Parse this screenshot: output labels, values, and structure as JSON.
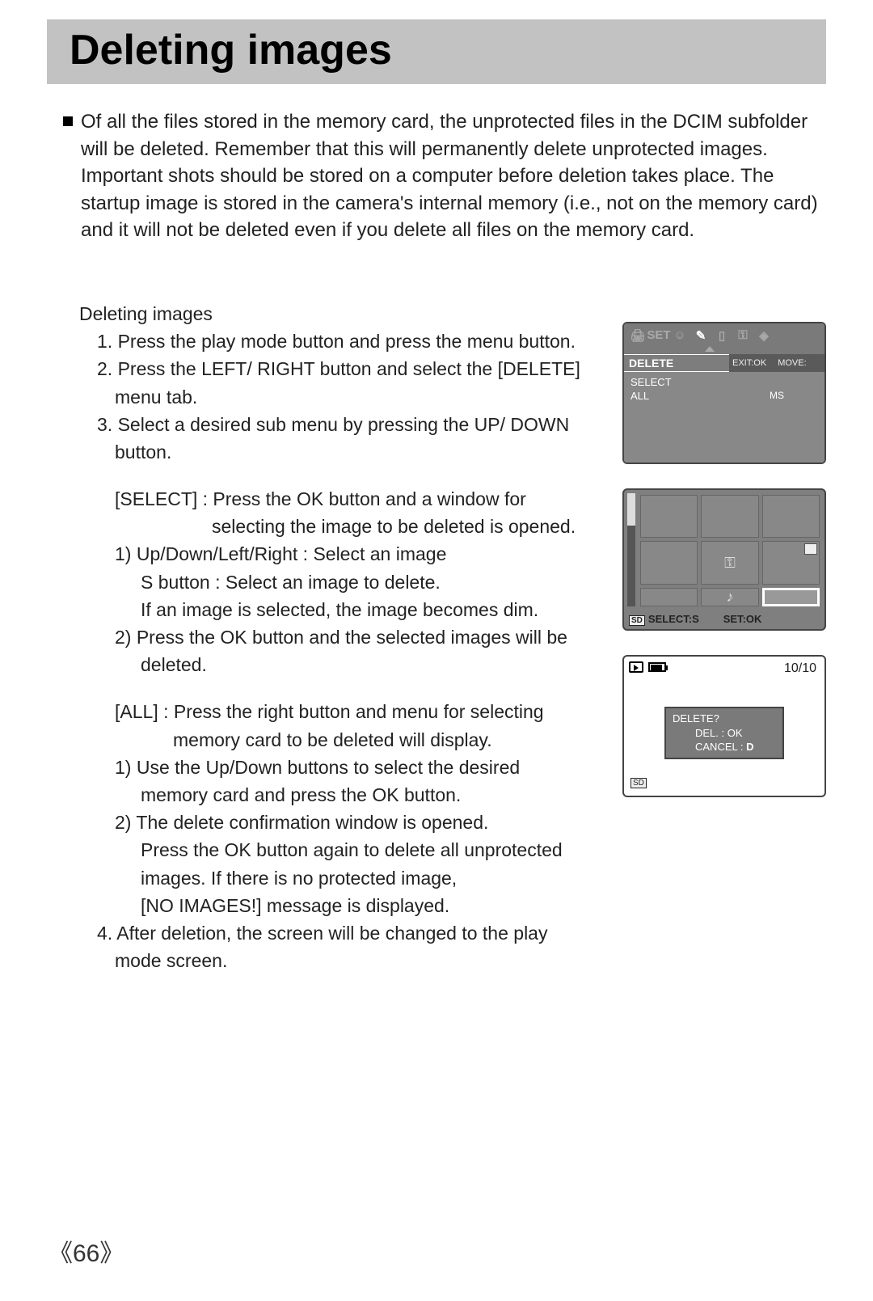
{
  "title": "Deleting images",
  "intro": "Of all the files stored in the memory card, the unprotected files in the DCIM subfolder will be deleted. Remember that this will permanently delete unprotected images. Important shots should be stored on a computer before deletion takes place. The startup image is stored in the camera's internal memory (i.e., not on the memory card) and it will not be deleted even if you delete all files on the memory card.",
  "section_heading": "Deleting images",
  "steps": {
    "s1": "1. Press the play mode button and press the menu button.",
    "s2a": "2. Press the LEFT/ RIGHT button and select the [DELETE]",
    "s2b": "menu tab.",
    "s3a": "3. Select a desired sub menu by pressing the UP/ DOWN",
    "s3b": "button.",
    "sel_a": "[SELECT] :  Press the OK button and a window for",
    "sel_b": "selecting the image to be deleted is opened.",
    "sub1a": "1) Up/Down/Left/Right : Select an image",
    "sub1b": "S button : Select an image to delete.",
    "sub1c": "If an image is selected, the image becomes dim.",
    "sub2a": "2) Press the OK button and the selected images will be",
    "sub2b": "deleted.",
    "all_a": "[ALL] : Press the right button and menu for selecting",
    "all_b": "memory card to be deleted will display.",
    "asub1a": "1) Use the Up/Down buttons to select the desired",
    "asub1b": "memory card and press the OK button.",
    "asub2a": "2) The delete confirmation window is opened.",
    "asub2b": "Press the OK button again to delete all unprotected",
    "asub2c": "images. If there is no protected image,",
    "asub2d": "[NO IMAGES!] message is displayed.",
    "s4a": "4. After deletion, the screen will be changed to the play",
    "s4b": "mode screen."
  },
  "fig1": {
    "tab_set": "SET",
    "title": "DELETE",
    "exit": "EXIT:OK",
    "move": "MOVE:",
    "opt1": "SELECT",
    "opt2": "ALL",
    "ms": "MS"
  },
  "fig2": {
    "select": "SELECT:S",
    "set": "SET:OK",
    "sd": "SD",
    "icon_key": "⚿",
    "icon_note": "♪"
  },
  "fig3": {
    "counter": "10/10",
    "line1": "DELETE?",
    "line2": "DEL. : OK",
    "line3_prefix": "CANCEL : ",
    "line3_sym": "D",
    "sd": "SD"
  },
  "page_number": "66"
}
